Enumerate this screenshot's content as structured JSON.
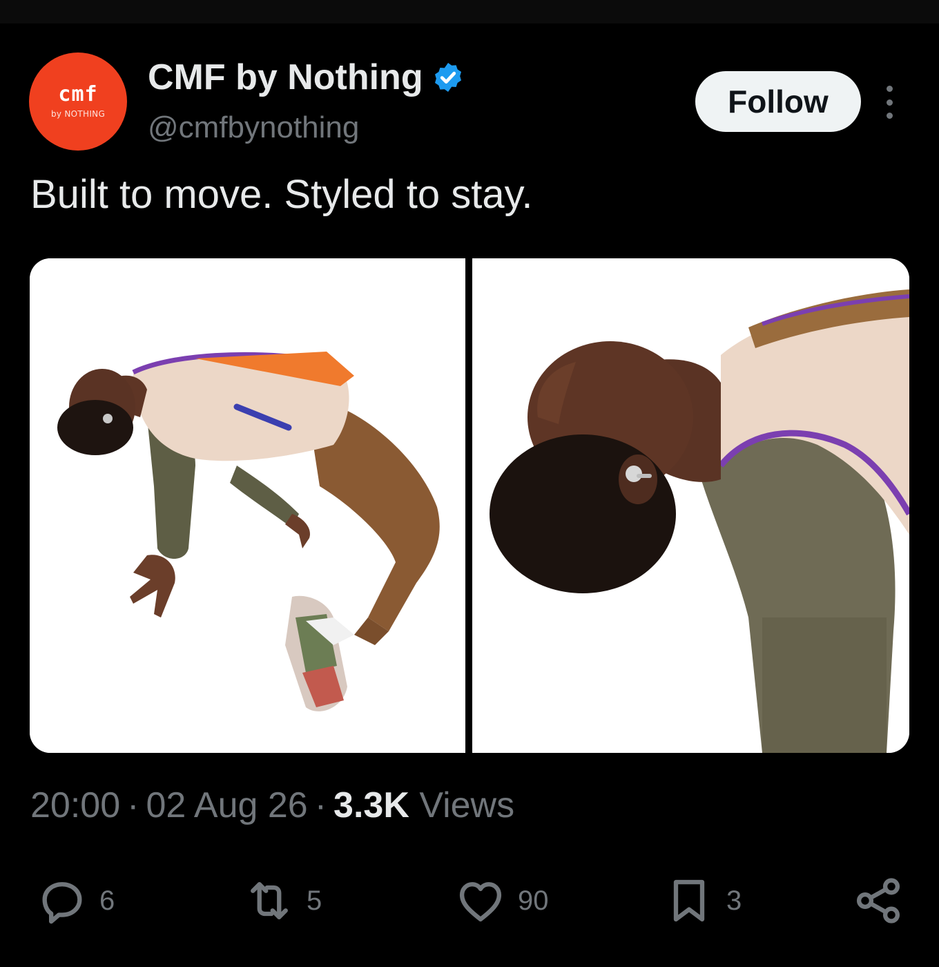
{
  "author": {
    "display_name": "CMF by Nothing",
    "handle": "@cmfbynothing",
    "verified": true,
    "avatar": {
      "mark": "cmf",
      "sub": "by NOTHING",
      "color": "#f0401f"
    }
  },
  "follow_button": {
    "label": "Follow"
  },
  "post": {
    "text": "Built to move. Styled to stay."
  },
  "media": {
    "count": 2,
    "images": [
      {
        "alt": "Person leaning backward mid-air wearing fleece vest, olive jacket, brown corduroy trousers and sneakers"
      },
      {
        "alt": "Close-up of person's head tilted back wearing an earbud"
      }
    ]
  },
  "meta": {
    "time": "20:00",
    "date": "02 Aug 26",
    "views_count": "3.3K",
    "views_label": "Views",
    "separator": "·"
  },
  "actions": {
    "reply": {
      "icon": "reply-icon",
      "count": "6"
    },
    "repost": {
      "icon": "repost-icon",
      "count": "5"
    },
    "like": {
      "icon": "like-icon",
      "count": "90"
    },
    "bookmark": {
      "icon": "bookmark-icon",
      "count": "3"
    },
    "share": {
      "icon": "share-icon"
    }
  },
  "colors": {
    "background": "#000000",
    "text_primary": "#e7e9ea",
    "text_secondary": "#71767b",
    "verified": "#1d9bf0",
    "follow_bg": "#eff3f4"
  }
}
